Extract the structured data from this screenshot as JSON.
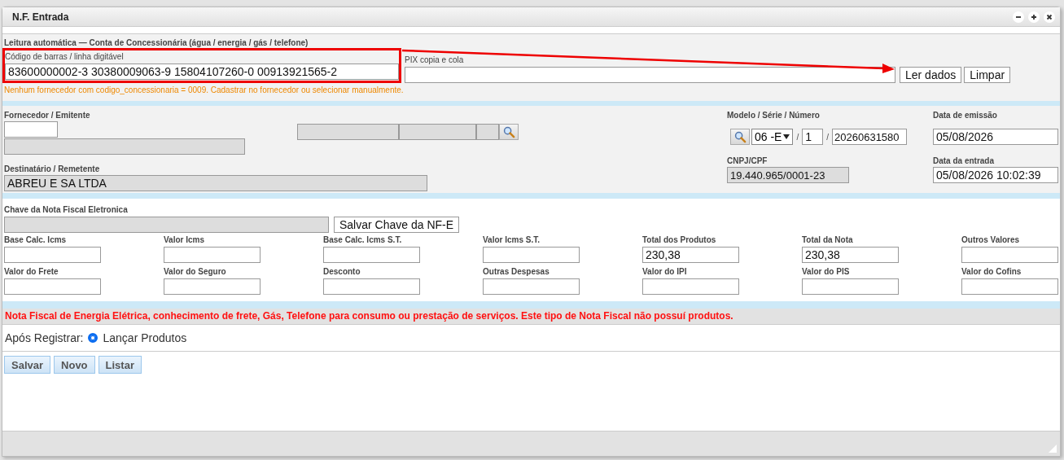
{
  "window": {
    "title": "N.F. Entrada"
  },
  "auto_read": {
    "heading": "Leitura automática — Conta de Concessionária (água / energia / gás / telefone)",
    "barcode": {
      "label": "Código de barras / linha digitável",
      "value": "83600000002-3 30380009063-9 15804107260-0 00913921565-2"
    },
    "pix": {
      "label": "PIX copia e cola"
    },
    "buttons": [
      "Ler dados",
      "Limpar"
    ],
    "warning": "Nenhum fornecedor com codigo_concessionaria = 0009. Cadastrar no fornecedor ou selecionar manualmente."
  },
  "header": {
    "supplier": {
      "label": "Fornecedor / Emitente",
      "lookup_fields": [
        {
          "disabled": true
        },
        {
          "disabled": true
        },
        {
          "disabled": true
        }
      ],
      "name_field": {
        "disabled": true
      }
    },
    "model": {
      "label": "Modelo / Série / Número",
      "model": "06 -E",
      "separators": [
        "/",
        "/"
      ],
      "series": "1",
      "number": "20260631580"
    },
    "issue_date": {
      "label": "Data de emissão",
      "value": "05/08/2026"
    },
    "recipient": {
      "label": "Destinatário / Remetente",
      "value": "ABREU E SA LTDA",
      "disabled": true
    },
    "cnpj": {
      "label": "CNPJ/CPF",
      "value": "19.440.965/0001-23",
      "disabled": true
    },
    "entry_date": {
      "label": "Data da entrada",
      "value": "05/08/2026 10:02:39"
    }
  },
  "nfe_key": {
    "label": "Chave da Nota Fiscal Eletronica",
    "button": "Salvar Chave da NF-E"
  },
  "totals": [
    {
      "label": "Base Calc. Icms"
    },
    {
      "label": "Valor Icms"
    },
    {
      "label": "Base Calc. Icms S.T."
    },
    {
      "label": "Valor Icms S.T."
    },
    {
      "label": "Total dos Produtos",
      "value": "230,38"
    },
    {
      "label": "Total da Nota",
      "value": "230,38"
    },
    {
      "label": "Outros Valores"
    },
    {
      "label": "Valor do Frete"
    },
    {
      "label": "Valor do Seguro"
    },
    {
      "label": "Desconto"
    },
    {
      "label": "Outras Despesas"
    },
    {
      "label": "Valor do IPI"
    },
    {
      "label": "Valor do PIS"
    },
    {
      "label": "Valor do Cofins"
    }
  ],
  "notice": "Nota Fiscal de Energia Elétrica, conhecimento de frete, Gás, Telefone para consumo ou prestação de serviços. Este tipo de Nota Fiscal não possuí produtos.",
  "after_register": {
    "label": "Após Registrar:",
    "option": {
      "label": "Lançar Produtos",
      "selected": true
    }
  },
  "actions": [
    "Salvar",
    "Novo",
    "Listar"
  ]
}
